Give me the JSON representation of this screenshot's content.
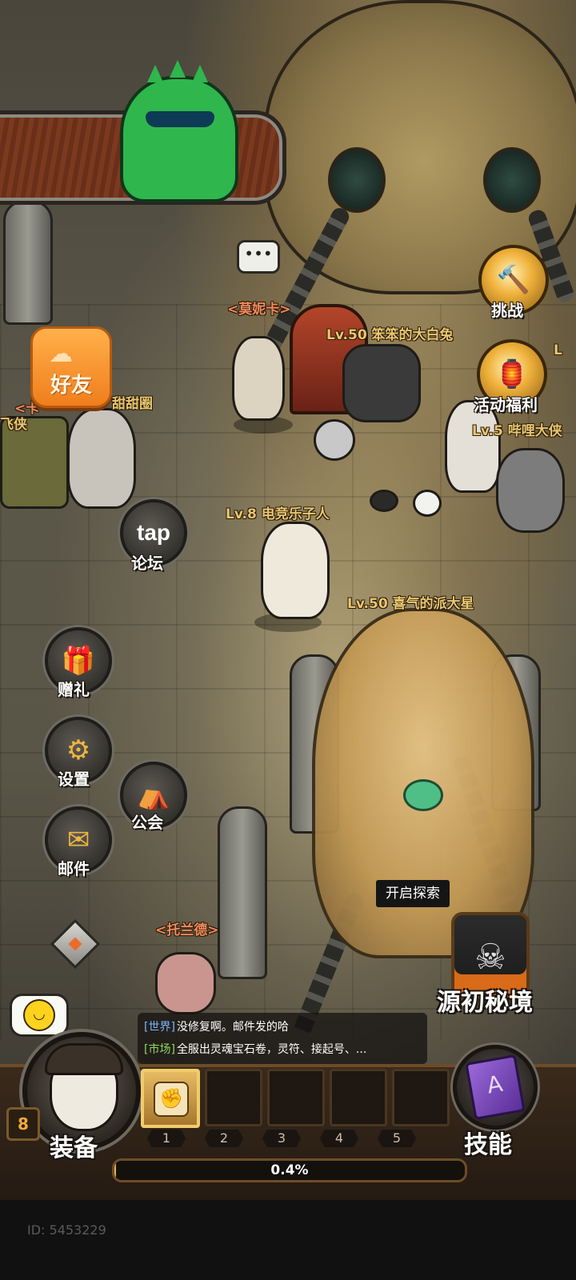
{
  "nameplates": {
    "monika": "<莫妮卡>",
    "big_white_rabbit": "Lv.50 笨笨的大白兔",
    "ka_prefix": "<卡",
    "sweet_donut": "甜甜圈",
    "feixia": "飞侠",
    "beep": "Lv.5 哔哩大侠",
    "lv_fragment": "L",
    "esports": "Lv.8 电竞乐子人",
    "happy_star": "Lv.50 喜气的派大星",
    "toland": "<托兰德>"
  },
  "menu": {
    "friends": "好友",
    "tap_logo": "tap",
    "forum": "论坛",
    "gift": "赠礼",
    "settings": "设置",
    "guild": "公会",
    "mail": "邮件",
    "challenge": "挑战",
    "event_rewards": "活动福利"
  },
  "icons": {
    "friends": "cloud-icon",
    "gift": "gift-box-icon",
    "settings": "gear-icon",
    "guild": "tent-icon",
    "mail": "envelope-icon",
    "challenge": "hammer-icon",
    "event_rewards": "lantern-icon",
    "chat": "speech-bubble-icon",
    "emoji": "smiley-icon",
    "map_toggle": "diamond-icon",
    "secret_realm": "horned-skull-icon",
    "skill": "spell-book-icon"
  },
  "realm": {
    "tooltip": "开启探索",
    "name": "源初秘境"
  },
  "chat": {
    "lines": [
      {
        "channel": "[世界]",
        "text": "没修复啊。邮件发的哈"
      },
      {
        "channel": "[市场]",
        "text": "全服出灵魂宝石卷，灵符、接起号、..."
      }
    ]
  },
  "player": {
    "level": "8",
    "equip_label": "装备",
    "skill_label": "技能",
    "xp_percent": 0.4,
    "xp_text": "0.4%",
    "id": "ID: 5453229"
  },
  "skill_slots": [
    "1",
    "2",
    "3",
    "4",
    "5"
  ],
  "colors": {
    "accent_gold": "#e8c770",
    "friend_orange": "#f07e1c",
    "xp_fill": "#e6b24a"
  }
}
